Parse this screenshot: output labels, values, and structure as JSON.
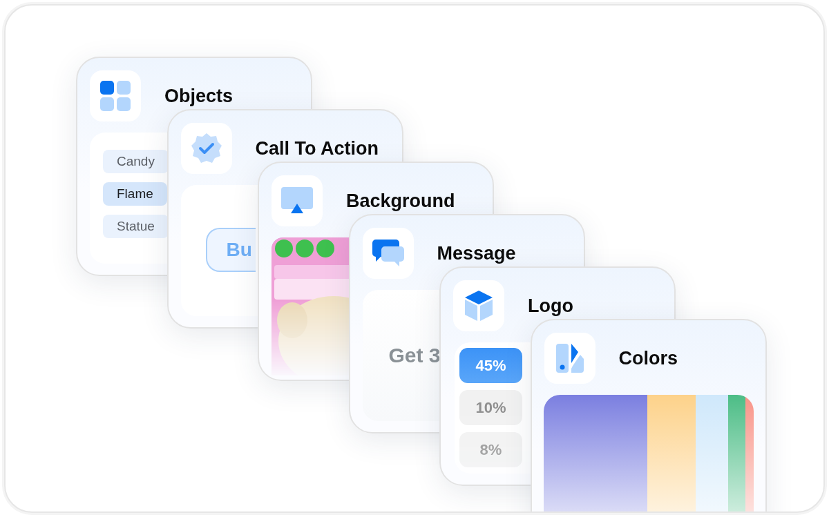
{
  "cards": [
    {
      "kind": "objects",
      "title": "Objects",
      "items": [
        {
          "label": "Candy",
          "selected": false
        },
        {
          "label": "Flame",
          "selected": true
        },
        {
          "label": "Statue",
          "selected": false
        }
      ]
    },
    {
      "kind": "cta",
      "title": "Call To Action",
      "button": "Bu"
    },
    {
      "kind": "background",
      "title": "Background"
    },
    {
      "kind": "message",
      "title": "Message",
      "text": "Get 3"
    },
    {
      "kind": "logo",
      "title": "Logo",
      "options": [
        {
          "label": "45%",
          "selected": true
        },
        {
          "label": "10%",
          "selected": false
        },
        {
          "label": "8%",
          "selected": false
        }
      ]
    },
    {
      "kind": "colors",
      "title": "Colors",
      "swatches": [
        {
          "color": "#7b7fe0"
        },
        {
          "color": "#fdd28a"
        },
        {
          "color": "#cfe8fb"
        },
        {
          "color": "#4cbd86"
        },
        {
          "color": "#f99488"
        }
      ]
    }
  ]
}
